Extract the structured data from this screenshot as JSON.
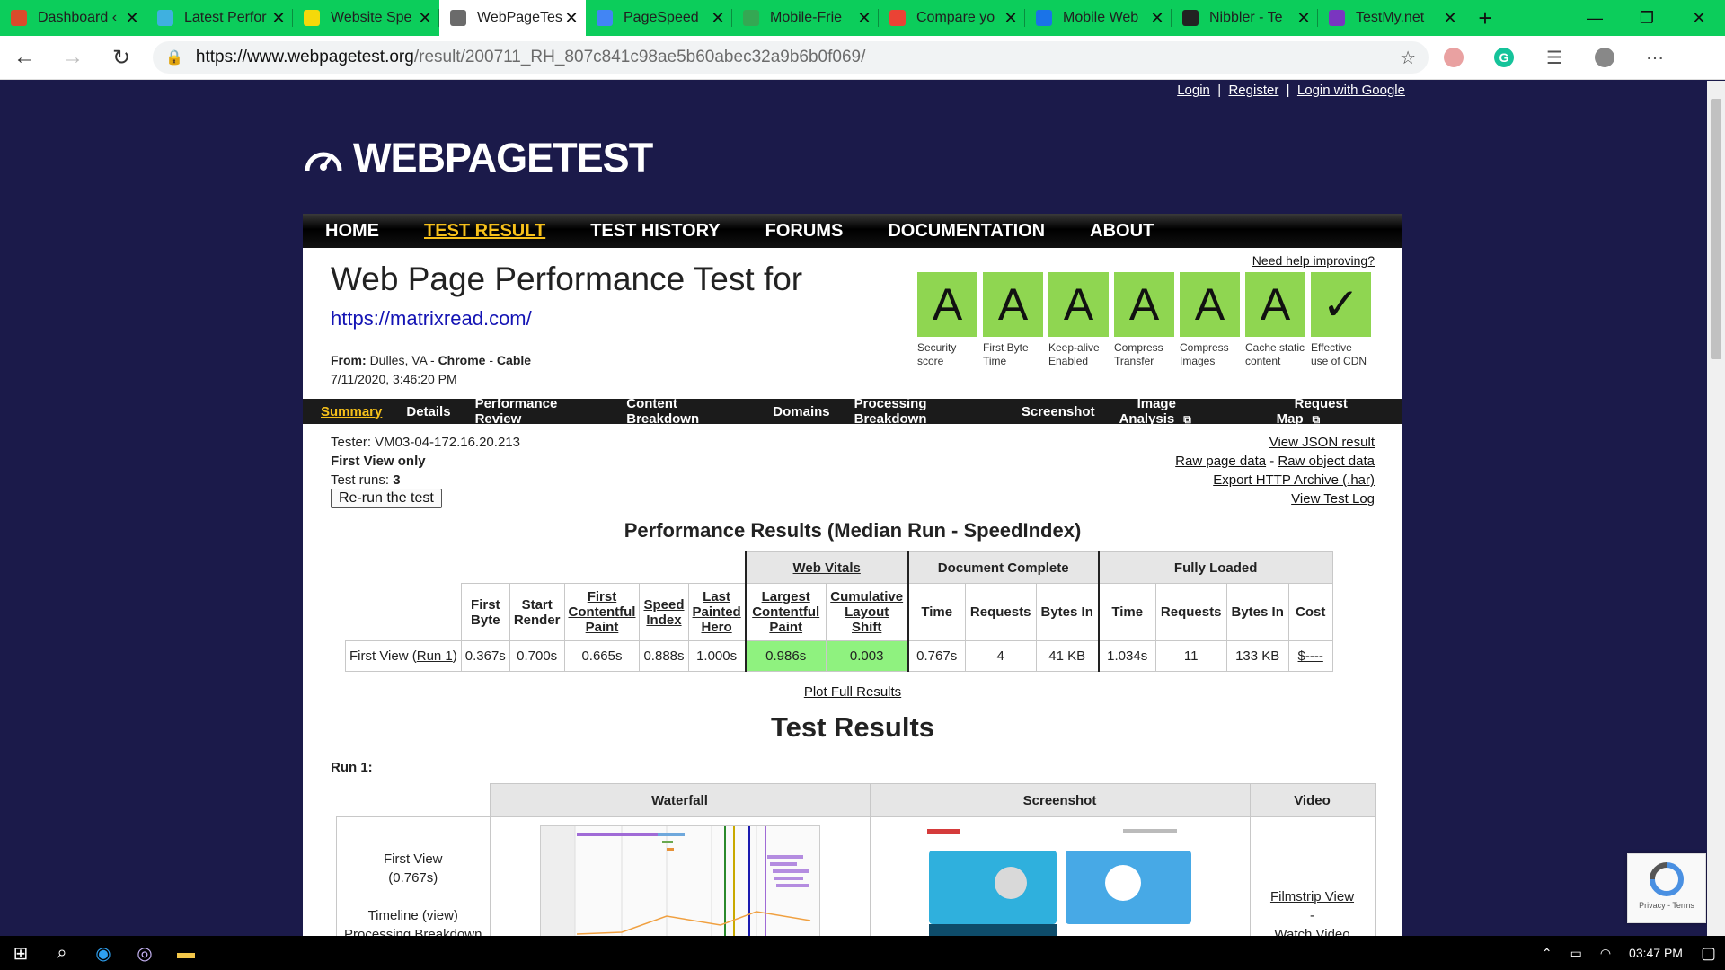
{
  "browser": {
    "tabs": [
      {
        "title": "Dashboard ‹",
        "icon": "wordpress-icon",
        "color": "#d94b2b",
        "active": false
      },
      {
        "title": "Latest Perfor",
        "icon": "analytics-icon",
        "color": "#3fb0e0",
        "active": false
      },
      {
        "title": "Website Spe",
        "icon": "pingdom-icon",
        "color": "#f5d90a",
        "active": false
      },
      {
        "title": "WebPageTes",
        "icon": "webpagetest-icon",
        "color": "#6b6b6b",
        "active": true
      },
      {
        "title": "PageSpeed",
        "icon": "pagespeed-icon",
        "color": "#4285f4",
        "active": false
      },
      {
        "title": "Mobile-Frie",
        "icon": "mobile-friendly-icon",
        "color": "#34a853",
        "active": false
      },
      {
        "title": "Compare yo",
        "icon": "google-icon",
        "color": "#ea4335",
        "active": false
      },
      {
        "title": "Mobile Web",
        "icon": "check-icon",
        "color": "#1a73e8",
        "active": false
      },
      {
        "title": "Nibbler - Te",
        "icon": "nibbler-icon",
        "color": "#222222",
        "active": false
      },
      {
        "title": "TestMy.net",
        "icon": "testmy-icon",
        "color": "#7a35c0",
        "active": false
      }
    ],
    "url_host": "https://www.webpagetest.org",
    "url_path": "/result/200711_RH_807c841c98ae5b60abec32a9b6b0f069/"
  },
  "page": {
    "toplinks": [
      "Login",
      "Register",
      "Login with Google"
    ],
    "logo_text": "WEBPAGETEST",
    "nav": [
      "HOME",
      "TEST RESULT",
      "TEST HISTORY",
      "FORUMS",
      "DOCUMENTATION",
      "ABOUT"
    ],
    "title": "Web Page Performance Test for",
    "tested_url": "https://matrixread.com/",
    "from_prefix": "From:",
    "from_location": "Dulles, VA",
    "from_browser": "Chrome",
    "from_connection": "Cable",
    "date": "7/11/2020, 3:46:20 PM",
    "help_link": "Need help improving?",
    "grades": [
      {
        "grade": "A",
        "label": "Security score"
      },
      {
        "grade": "A",
        "label": "First Byte Time"
      },
      {
        "grade": "A",
        "label": "Keep-alive Enabled"
      },
      {
        "grade": "A",
        "label": "Compress Transfer"
      },
      {
        "grade": "A",
        "label": "Compress Images"
      },
      {
        "grade": "A",
        "label": "Cache static content"
      },
      {
        "grade": "✓",
        "label": "Effective use of CDN"
      }
    ],
    "subnav": [
      "Summary",
      "Details",
      "Performance Review",
      "Content Breakdown",
      "Domains",
      "Processing Breakdown",
      "Screenshot",
      "Image Analysis",
      "Request Map"
    ],
    "tester": "Tester: VM03-04-172.16.20.213",
    "first_view_only": "First View only",
    "test_runs_label": "Test runs:",
    "test_runs": "3",
    "rerun_button": "Re-run the test",
    "result_links": {
      "json": "View JSON result",
      "raw_page": "Raw page data",
      "raw_object": "Raw object data",
      "har": "Export HTTP Archive (.har)",
      "log": "View Test Log"
    },
    "perf_heading": "Performance Results (Median Run - SpeedIndex)",
    "results_table": {
      "groups": [
        "Web Vitals",
        "Document Complete",
        "Fully Loaded"
      ],
      "columns": [
        "First Byte",
        "Start Render",
        "First Contentful Paint",
        "Speed Index",
        "Last Painted Hero",
        "Largest Contentful Paint",
        "Cumulative Layout Shift",
        "Time",
        "Requests",
        "Bytes In",
        "Time",
        "Requests",
        "Bytes In",
        "Cost"
      ],
      "row_label": "First View (",
      "row_link": "Run 1",
      "row_label_end": ")",
      "values": [
        "0.367s",
        "0.700s",
        "0.665s",
        "0.888s",
        "1.000s",
        "0.986s",
        "0.003",
        "0.767s",
        "4",
        "41 KB",
        "1.034s",
        "11",
        "133 KB",
        "$----"
      ]
    },
    "plot_link": "Plot Full Results",
    "test_results_heading": "Test Results",
    "run_label": "Run 1:",
    "runs_table": {
      "headers": [
        "Waterfall",
        "Screenshot",
        "Video"
      ],
      "first_view": "First View",
      "first_view_time": "(0.767s)",
      "timeline": "Timeline",
      "timeline_view": "view",
      "processing": "Processing Breakdown",
      "filmstrip": "Filmstrip View",
      "dash": "-",
      "watch": "Watch Video"
    },
    "recaptcha": "Privacy - Terms"
  },
  "taskbar": {
    "time": "03:47 PM"
  }
}
